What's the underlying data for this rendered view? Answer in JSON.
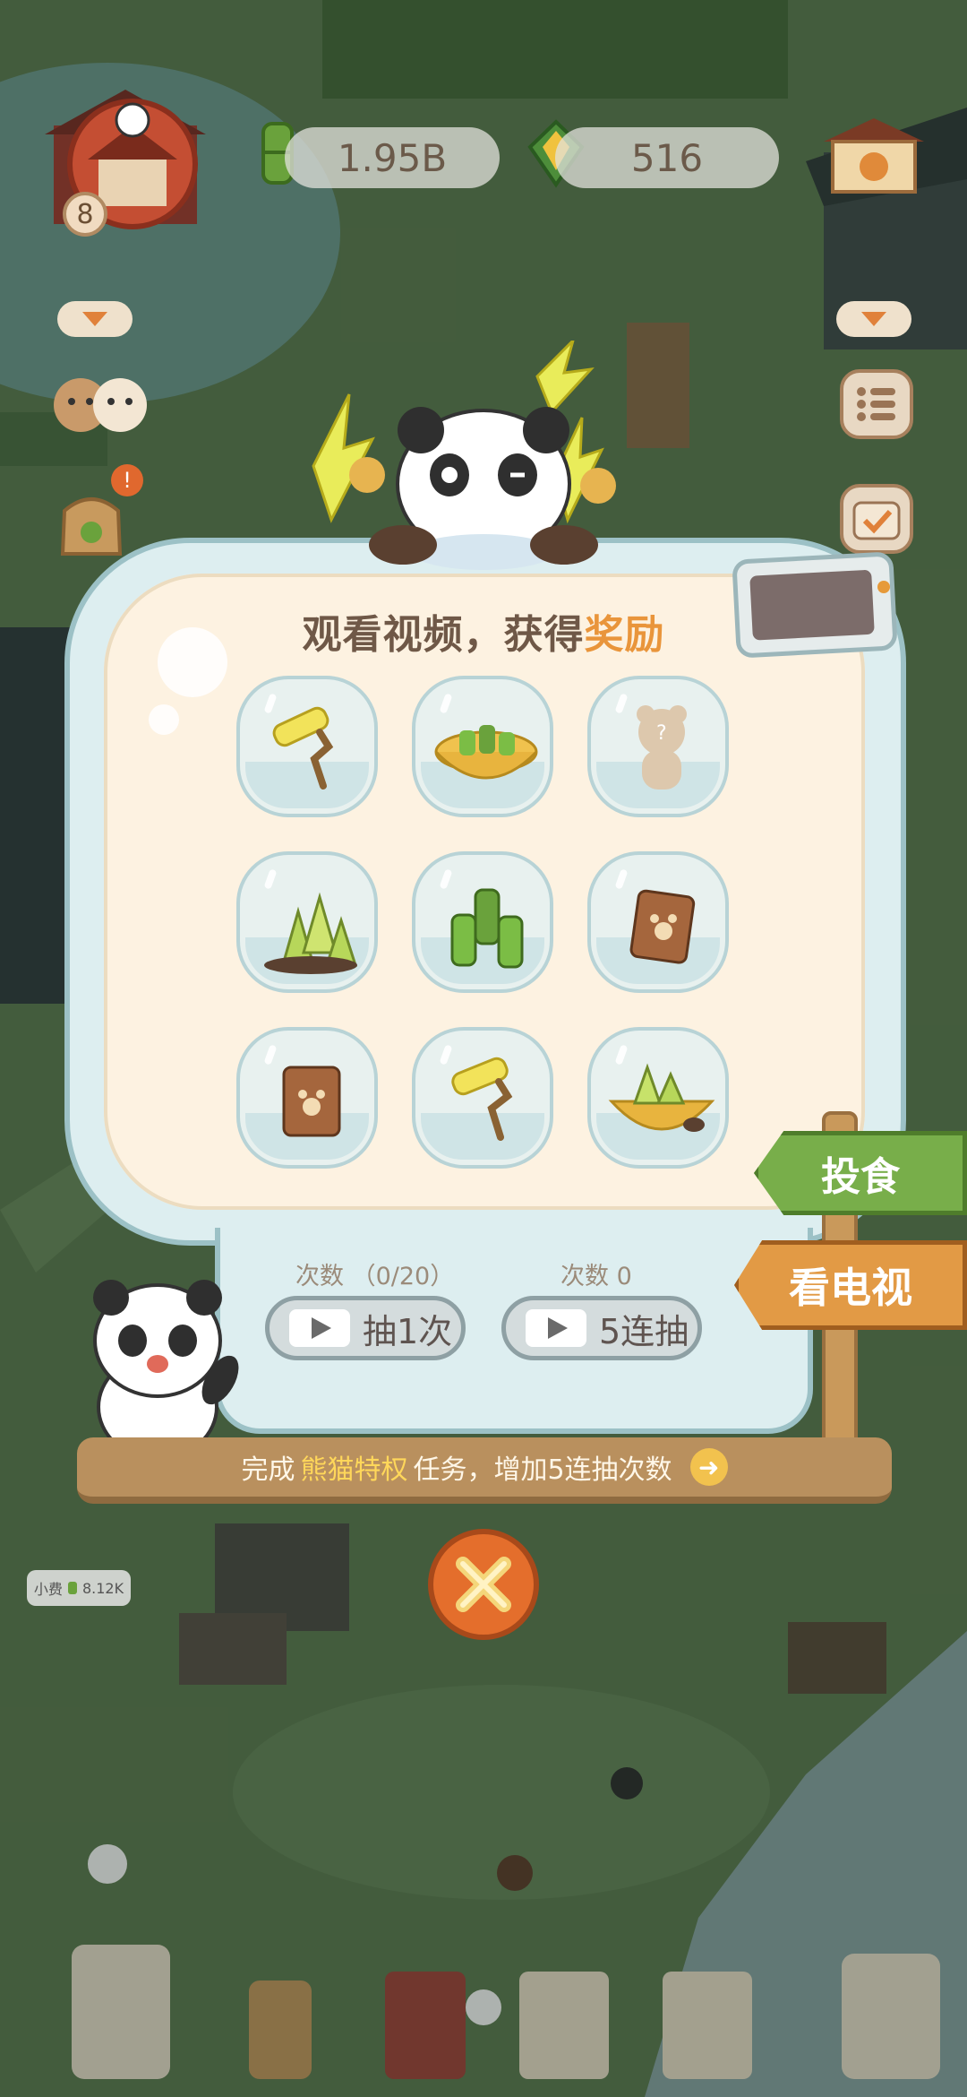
{
  "resources": {
    "bamboo_amount": "1.95B",
    "gems_amount": "516"
  },
  "player": {
    "level": "8"
  },
  "panel": {
    "title_prefix": "观看视频，获得",
    "title_highlight": "奖励",
    "slots": [
      {
        "item": "paint-roller-icon"
      },
      {
        "item": "bamboo-bowl-icon"
      },
      {
        "item": "mystery-bear-icon"
      },
      {
        "item": "bamboo-shoots-icon"
      },
      {
        "item": "bamboo-logs-icon"
      },
      {
        "item": "menu-book-icon"
      },
      {
        "item": "menu-book-icon"
      },
      {
        "item": "paint-roller-icon"
      },
      {
        "item": "shoots-bowl-icon"
      }
    ]
  },
  "draw": {
    "single_count_label": "次数 （0/20）",
    "single_button": "抽1次",
    "multi_count_label": "次数  0",
    "multi_button": "5连抽"
  },
  "footer": {
    "prefix": "完成",
    "highlight": "熊猫特权",
    "suffix": "任务，增加5连抽次数"
  },
  "signs": {
    "feed": "投食",
    "watch_tv": "看电视"
  },
  "tip": {
    "label": "小费",
    "value": "8.12K"
  },
  "colors": {
    "accent_orange": "#e9953b",
    "highlight_yellow": "#ffd75a",
    "sign_green": "#78ae4a",
    "sign_orange": "#e29a45",
    "close_button": "#e46e2c"
  }
}
